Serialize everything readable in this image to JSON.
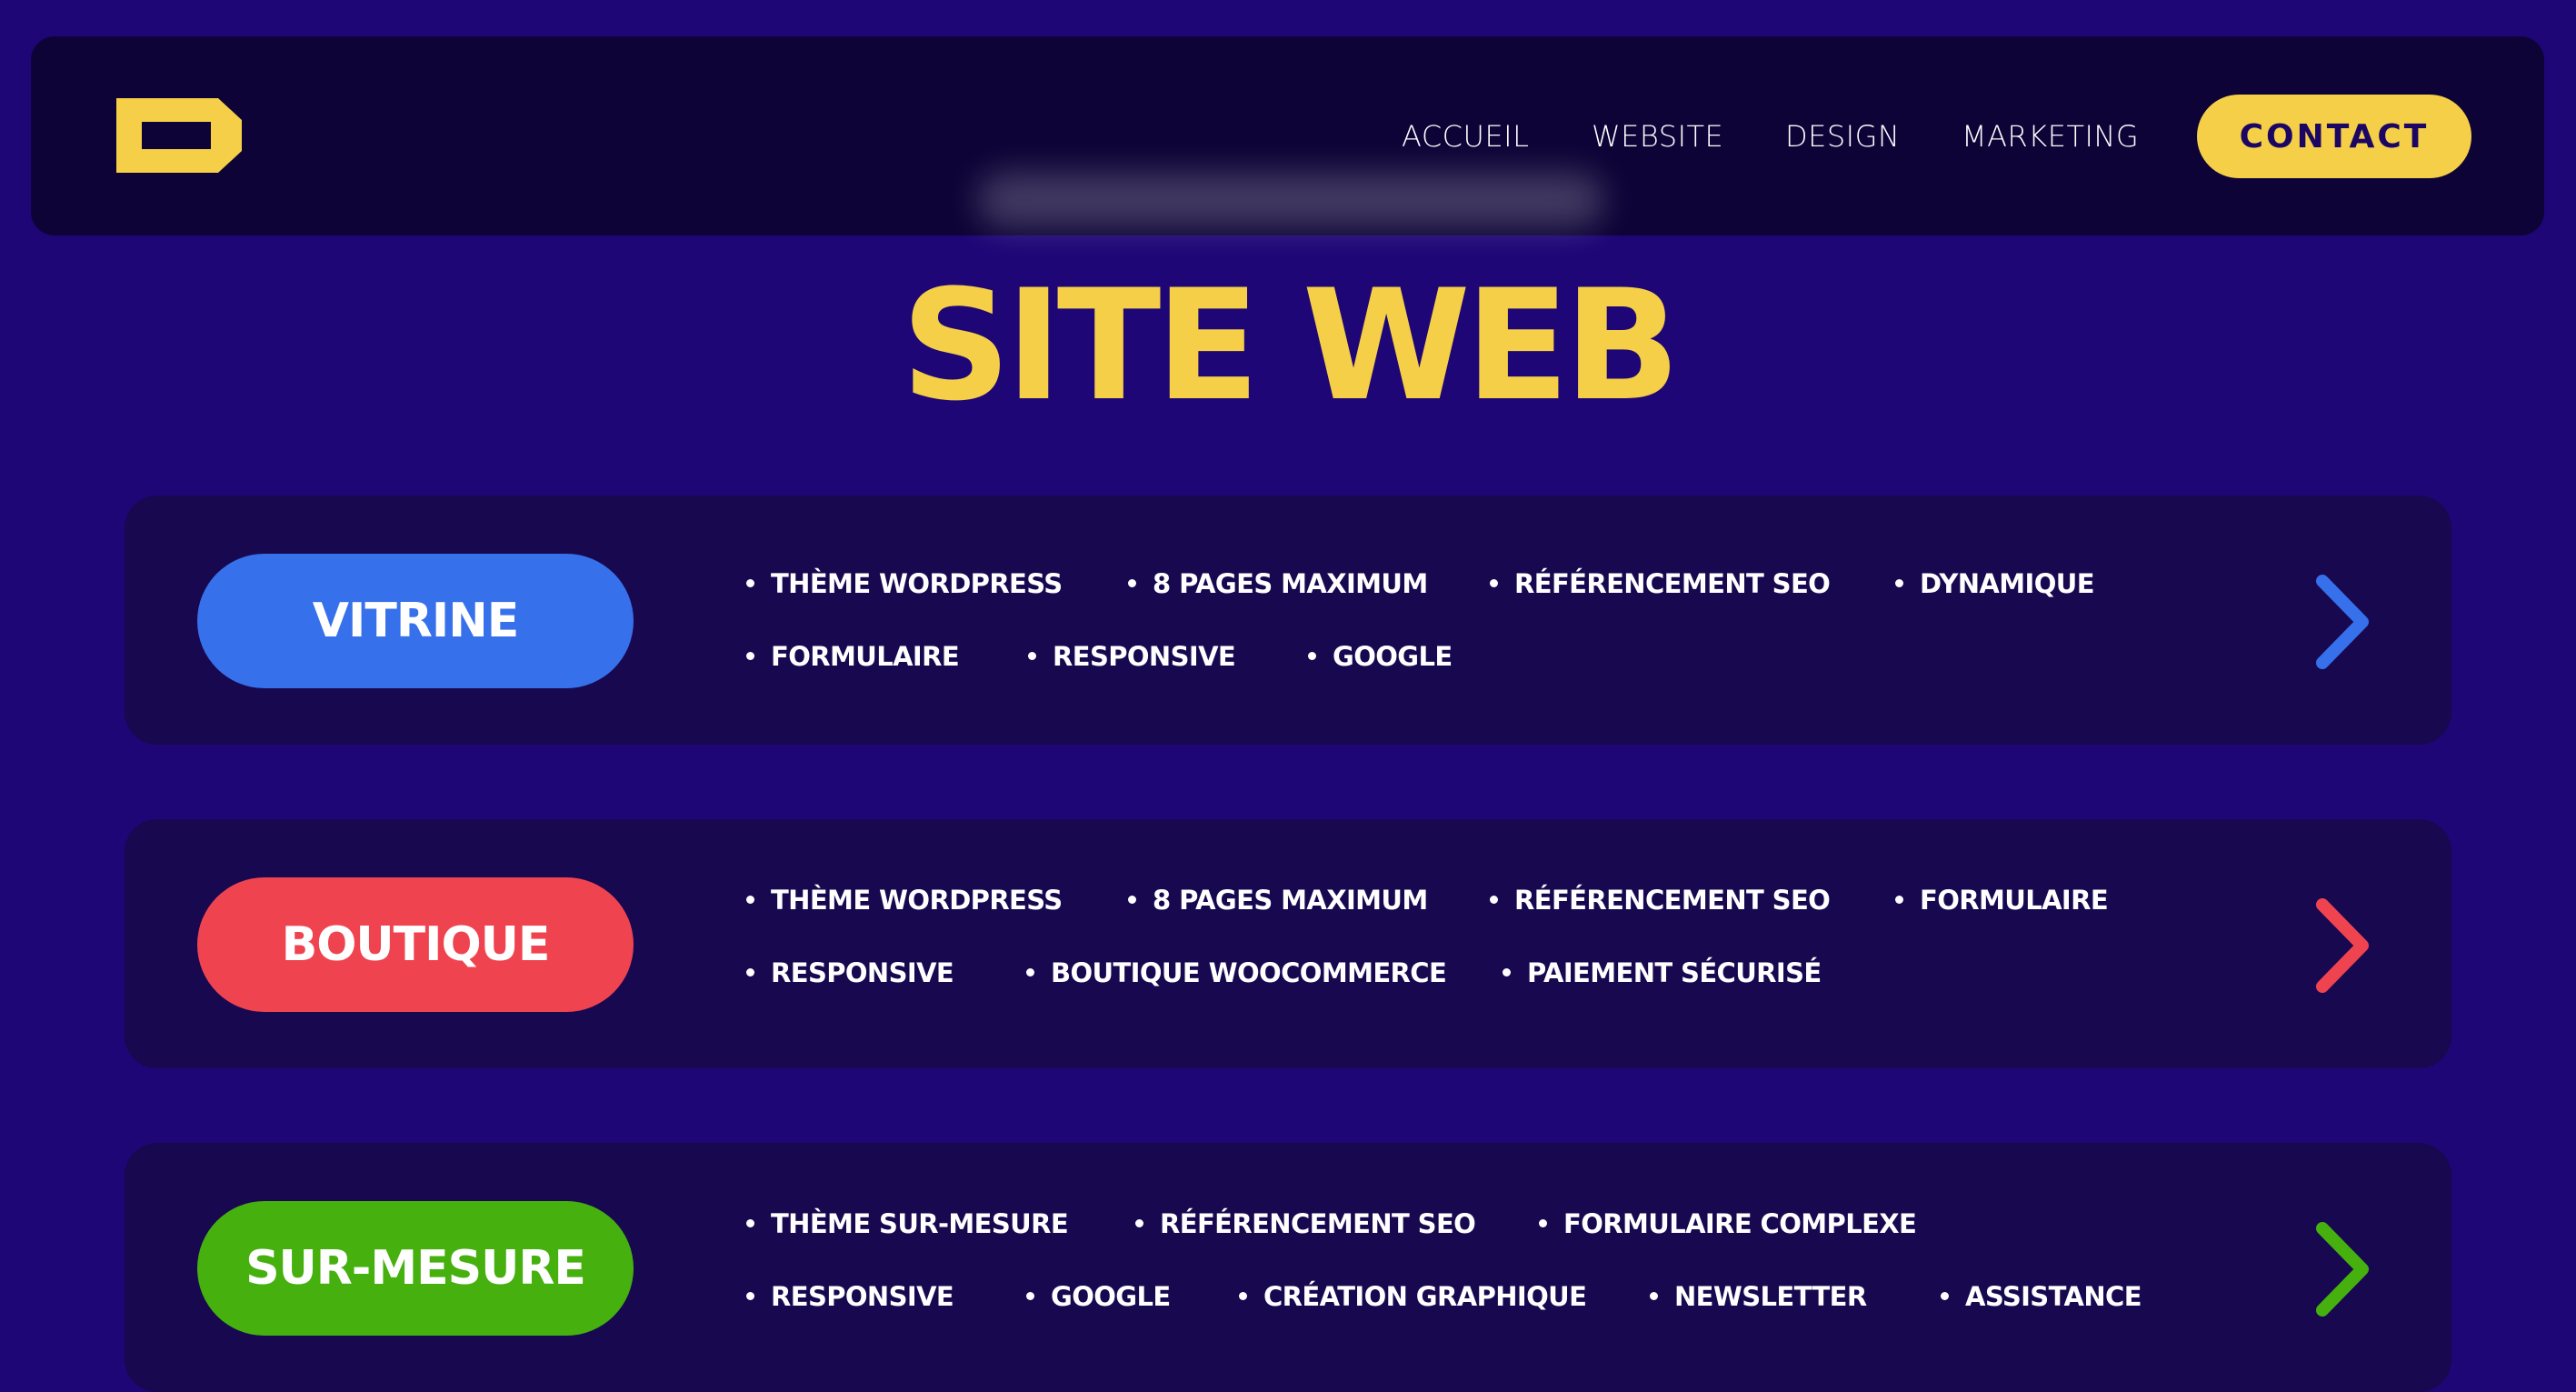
{
  "nav": {
    "items": [
      "ACCUEIL",
      "WEBSITE",
      "DESIGN",
      "MARKETING"
    ],
    "contact_label": "CONTACT"
  },
  "page": {
    "title": "SITE WEB"
  },
  "colors": {
    "background": "#1e0676",
    "header": "#0d0336",
    "card": "#170850",
    "accent_yellow": "#f4cf47",
    "vitrine": "#3670ea",
    "boutique": "#ef4450",
    "sur_mesure": "#46b00f"
  },
  "offers": [
    {
      "name": "VITRINE",
      "color": "#3670ea",
      "features": [
        "THÈME WORDPRESS",
        "8 PAGES MAXIMUM",
        "RÉFÉRENCEMENT SEO",
        "DYNAMIQUE",
        "FORMULAIRE",
        "RESPONSIVE",
        "GOOGLE"
      ]
    },
    {
      "name": "BOUTIQUE",
      "color": "#ef4450",
      "features": [
        "THÈME WORDPRESS",
        "8 PAGES MAXIMUM",
        "RÉFÉRENCEMENT SEO",
        "FORMULAIRE",
        "RESPONSIVE",
        "BOUTIQUE WOOCOMMERCE",
        "PAIEMENT SÉCURISÉ"
      ]
    },
    {
      "name": "SUR-MESURE",
      "color": "#46b00f",
      "features": [
        "THÈME SUR-MESURE",
        "RÉFÉRENCEMENT SEO",
        "FORMULAIRE COMPLEXE",
        "RESPONSIVE",
        "GOOGLE",
        "CRÉATION GRAPHIQUE",
        "NEWSLETTER",
        "ASSISTANCE"
      ]
    }
  ]
}
